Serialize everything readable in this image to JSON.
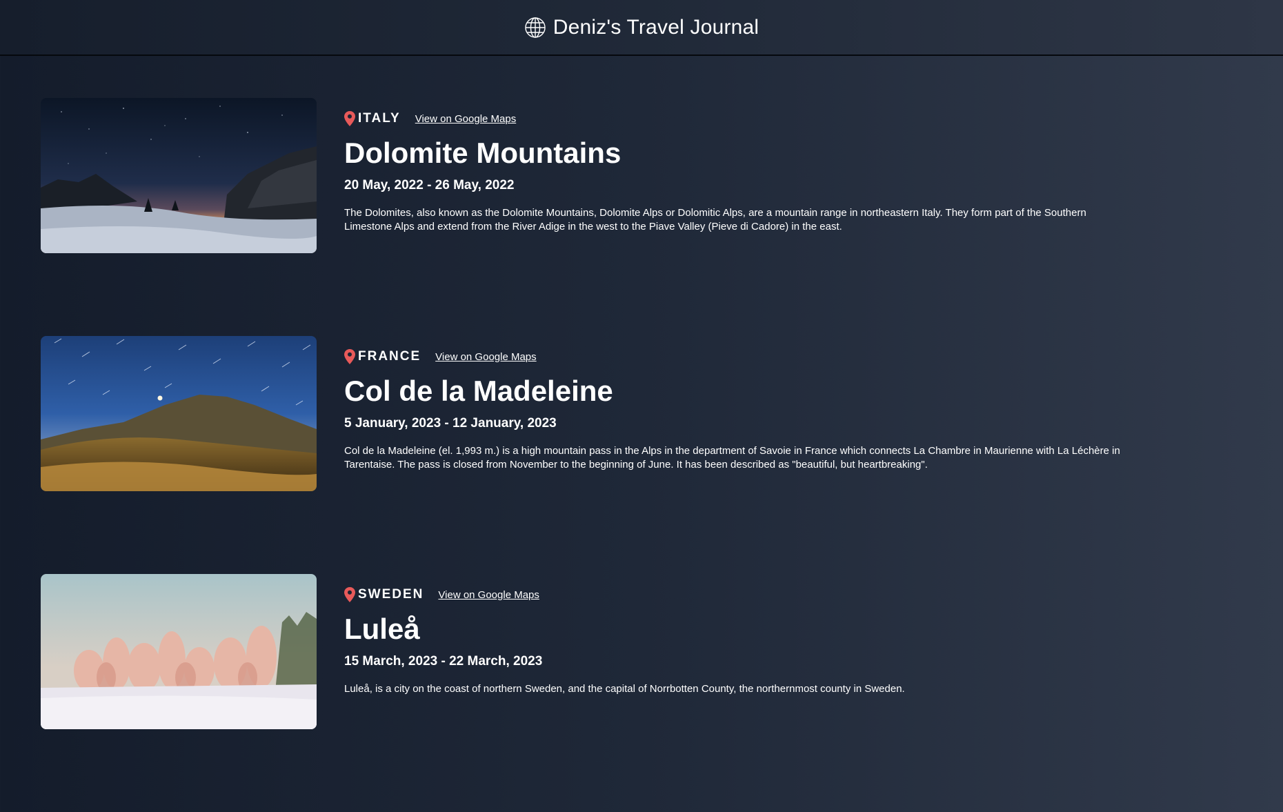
{
  "header": {
    "title": "Deniz's Travel Journal",
    "icon": "globe-icon"
  },
  "colors": {
    "pin": "#e85a5a",
    "text": "#ffffff",
    "background_left": "#141c2b",
    "background_right": "#313a4b"
  },
  "entries": [
    {
      "country": "ITALY",
      "maps_link": "View on Google Maps",
      "title": "Dolomite Mountains",
      "dates": "20 May, 2022 - 26 May, 2022",
      "description": "The Dolomites, also known as the Dolomite Mountains, Dolomite Alps or Dolomitic Alps, are a mountain range in northeastern Italy. They form part of the Southern Limestone Alps and extend from the River Adige in the west to the Piave Valley (Pieve di Cadore) in the east."
    },
    {
      "country": "FRANCE",
      "maps_link": "View on Google Maps",
      "title": "Col de la Madeleine",
      "dates": "5 January, 2023 - 12 January, 2023",
      "description": "Col de la Madeleine (el. 1,993 m.) is a high mountain pass in the Alps in the department of Savoie in France which connects La Chambre in Maurienne with La Léchère in Tarentaise. The pass is closed from November to the beginning of June. It has been described as \"beautiful, but heartbreaking\"."
    },
    {
      "country": "SWEDEN",
      "maps_link": "View on Google Maps",
      "title": "Luleå",
      "dates": "15 March, 2023 - 22 March, 2023",
      "description": "Luleå, is a city on the coast of northern Sweden, and the capital of Norrbotten County, the northernmost county in Sweden."
    }
  ]
}
